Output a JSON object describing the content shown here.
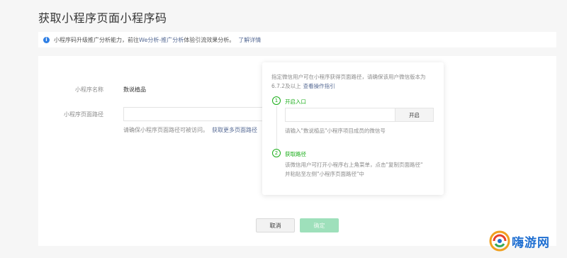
{
  "page": {
    "title": "获取小程序页面小程序码"
  },
  "notice": {
    "text_before": "小程序码升级推广分析能力，前往",
    "highlight": "We分析-推广分析",
    "text_after": "体验引流效果分析。",
    "link": "了解详情"
  },
  "form": {
    "name_label": "小程序名称",
    "name_value": "数说植品",
    "path_label": "小程序页面路径",
    "path_value": "",
    "hint_text": "请确保小程序页面路径可被访问。",
    "hint_link": "获取更多页面路径"
  },
  "popover": {
    "desc": "指定微信用户可在小程序获得页面路径，请确保该用户微信版本为6.7.2及以上",
    "desc_link": "查看操作指引",
    "step1": {
      "num": "1",
      "title": "开启入口",
      "input_value": "",
      "button": "开启",
      "hint": "请输入\"数说植品\"小程序项目成员的微信号"
    },
    "step2": {
      "num": "2",
      "title": "获取路径",
      "line1": "该微信用户可打开小程序右上角菜单，点击\"复制页面路径\"",
      "line2": "并粘贴至左侧\"小程序页面路径\"中"
    }
  },
  "actions": {
    "cancel": "取消",
    "confirm": "确定"
  },
  "watermark": {
    "text": "嗨游网"
  },
  "colors": {
    "accent_green": "#1aad19",
    "link_blue": "#576b95",
    "info_blue": "#2e7fe5"
  }
}
